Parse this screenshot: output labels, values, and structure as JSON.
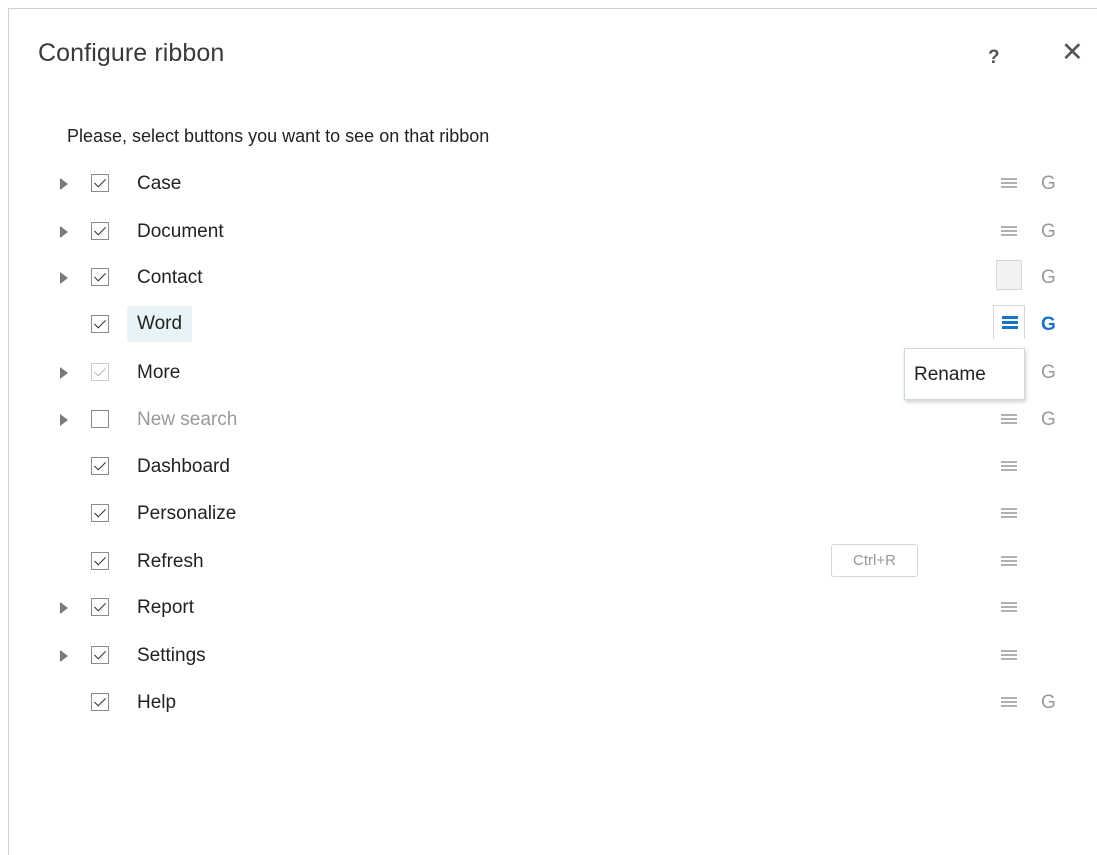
{
  "dialog": {
    "title": "Configure ribbon",
    "help_label": "?",
    "close_label": "✕",
    "instruction": "Please, select buttons you want to see on that ribbon"
  },
  "items": [
    {
      "label": "Case",
      "expandable": true,
      "checked": true,
      "g": "G"
    },
    {
      "label": "Document",
      "expandable": true,
      "checked": true,
      "g": "G"
    },
    {
      "label": "Contact",
      "expandable": true,
      "checked": true,
      "g": "G"
    },
    {
      "label": "Word",
      "expandable": false,
      "checked": true,
      "g": "G"
    },
    {
      "label": "More",
      "expandable": true,
      "checked": true,
      "g": "G"
    },
    {
      "label": "New search",
      "expandable": true,
      "checked": false,
      "g": "G"
    },
    {
      "label": "Dashboard",
      "expandable": false,
      "checked": true,
      "g": ""
    },
    {
      "label": "Personalize",
      "expandable": false,
      "checked": true,
      "g": ""
    },
    {
      "label": "Refresh",
      "expandable": false,
      "checked": true,
      "g": "",
      "shortcut": "Ctrl+R"
    },
    {
      "label": "Report",
      "expandable": true,
      "checked": true,
      "g": ""
    },
    {
      "label": "Settings",
      "expandable": true,
      "checked": true,
      "g": ""
    },
    {
      "label": "Help",
      "expandable": false,
      "checked": true,
      "g": "G"
    }
  ],
  "tooltip": {
    "rename_label": "Rename"
  },
  "colors": {
    "accent": "#1a73c8",
    "selected_bg": "#e8f3f7",
    "muted": "#9a9a9a"
  }
}
